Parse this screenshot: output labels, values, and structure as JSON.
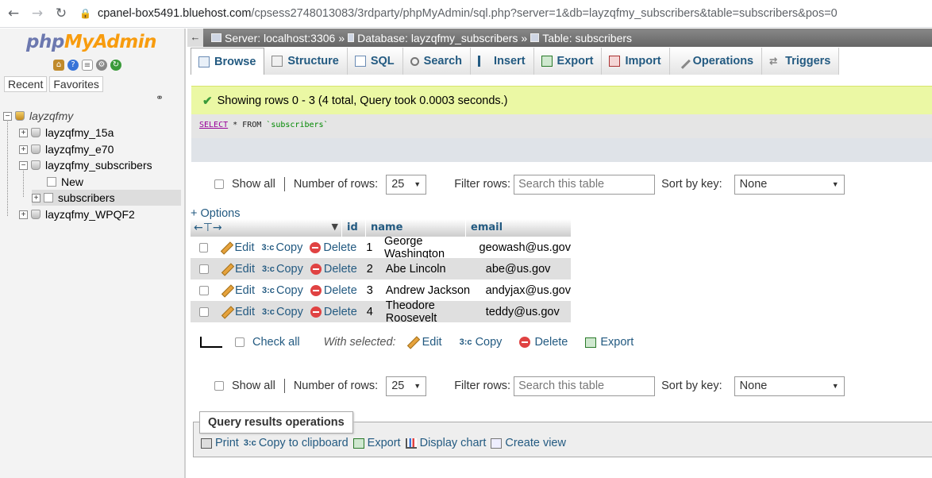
{
  "browser": {
    "url_host": "cpanel-box5491.bluehost.com",
    "url_path": "/cpsess2748013083/3rdparty/phpMyAdmin/sql.php?server=1&db=layzqfmy_subscribers&table=subscribers&pos=0"
  },
  "sidebar": {
    "logo_php": "php",
    "logo_myadmin": "MyAdmin",
    "recent_label": "Recent",
    "favorites_label": "Favorites",
    "tree": {
      "root": "layzqfmy",
      "dbs": [
        "layzqfmy_15a",
        "layzqfmy_e70",
        "layzqfmy_subscribers",
        "layzqfmy_WPQF2"
      ],
      "new_label": "New",
      "table_label": "subscribers"
    }
  },
  "breadcrumb": {
    "server": "Server: localhost:3306",
    "database": "Database: layzqfmy_subscribers",
    "table": "Table: subscribers"
  },
  "tabs": [
    "Browse",
    "Structure",
    "SQL",
    "Search",
    "Insert",
    "Export",
    "Import",
    "Operations",
    "Triggers"
  ],
  "notice": "Showing rows 0 - 3 (4 total, Query took 0.0003 seconds.)",
  "sql": {
    "select": "SELECT",
    "rest": " * FROM ",
    "table": "`subscribers`"
  },
  "nav": {
    "show_all": "Show all",
    "num_rows_label": "Number of rows:",
    "num_rows_value": "25",
    "filter_label": "Filter rows:",
    "filter_placeholder": "Search this table",
    "sort_label": "Sort by key:",
    "sort_value": "None"
  },
  "options_link": "+ Options",
  "table": {
    "columns": [
      "id",
      "name",
      "email"
    ],
    "action_labels": {
      "edit": "Edit",
      "copy": "Copy",
      "delete": "Delete"
    },
    "rows": [
      {
        "id": "1",
        "name": "George Washington",
        "email": "geowash@us.gov"
      },
      {
        "id": "2",
        "name": "Abe Lincoln",
        "email": "abe@us.gov"
      },
      {
        "id": "3",
        "name": "Andrew Jackson",
        "email": "andyjax@us.gov"
      },
      {
        "id": "4",
        "name": "Theodore Roosevelt",
        "email": "teddy@us.gov"
      }
    ]
  },
  "with_selected": {
    "check_all": "Check all",
    "label": "With selected:",
    "edit": "Edit",
    "copy": "Copy",
    "delete": "Delete",
    "export": "Export"
  },
  "query_ops": {
    "title": "Query results operations",
    "print": "Print",
    "copy_clipboard": "Copy to clipboard",
    "export": "Export",
    "display_chart": "Display chart",
    "create_view": "Create view"
  }
}
